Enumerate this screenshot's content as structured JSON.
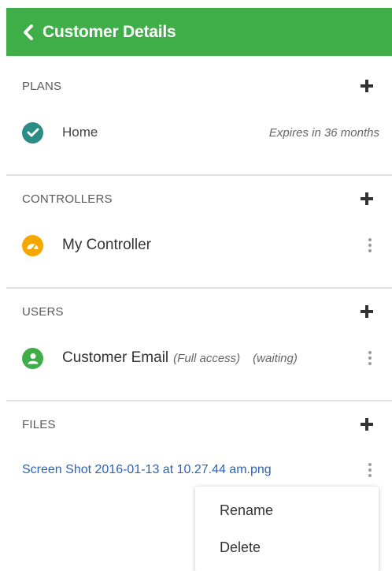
{
  "header": {
    "title": "Customer Details",
    "back_icon": "chevron-left-icon",
    "color": "#3fae48"
  },
  "plans": {
    "title": "PLANS",
    "items": [
      {
        "label": "Home",
        "note": "Expires in 36 months",
        "icon": "check-icon",
        "color": "#2a8c84"
      }
    ]
  },
  "controllers": {
    "title": "CONTROLLERS",
    "items": [
      {
        "label": "My Controller",
        "icon": "gauge-icon",
        "color": "#f5a700"
      }
    ]
  },
  "users": {
    "title": "USERS",
    "items": [
      {
        "label": "Customer Email",
        "access": "(Full access)",
        "status": "(waiting)",
        "icon": "user-icon",
        "color": "#3fae48"
      }
    ]
  },
  "files": {
    "title": "FILES",
    "items": [
      {
        "label": "Screen Shot 2016-01-13 at 10.27.44 am.png",
        "color": "#2c63b5"
      }
    ]
  },
  "context_menu": {
    "items": [
      "Rename",
      "Delete"
    ]
  }
}
